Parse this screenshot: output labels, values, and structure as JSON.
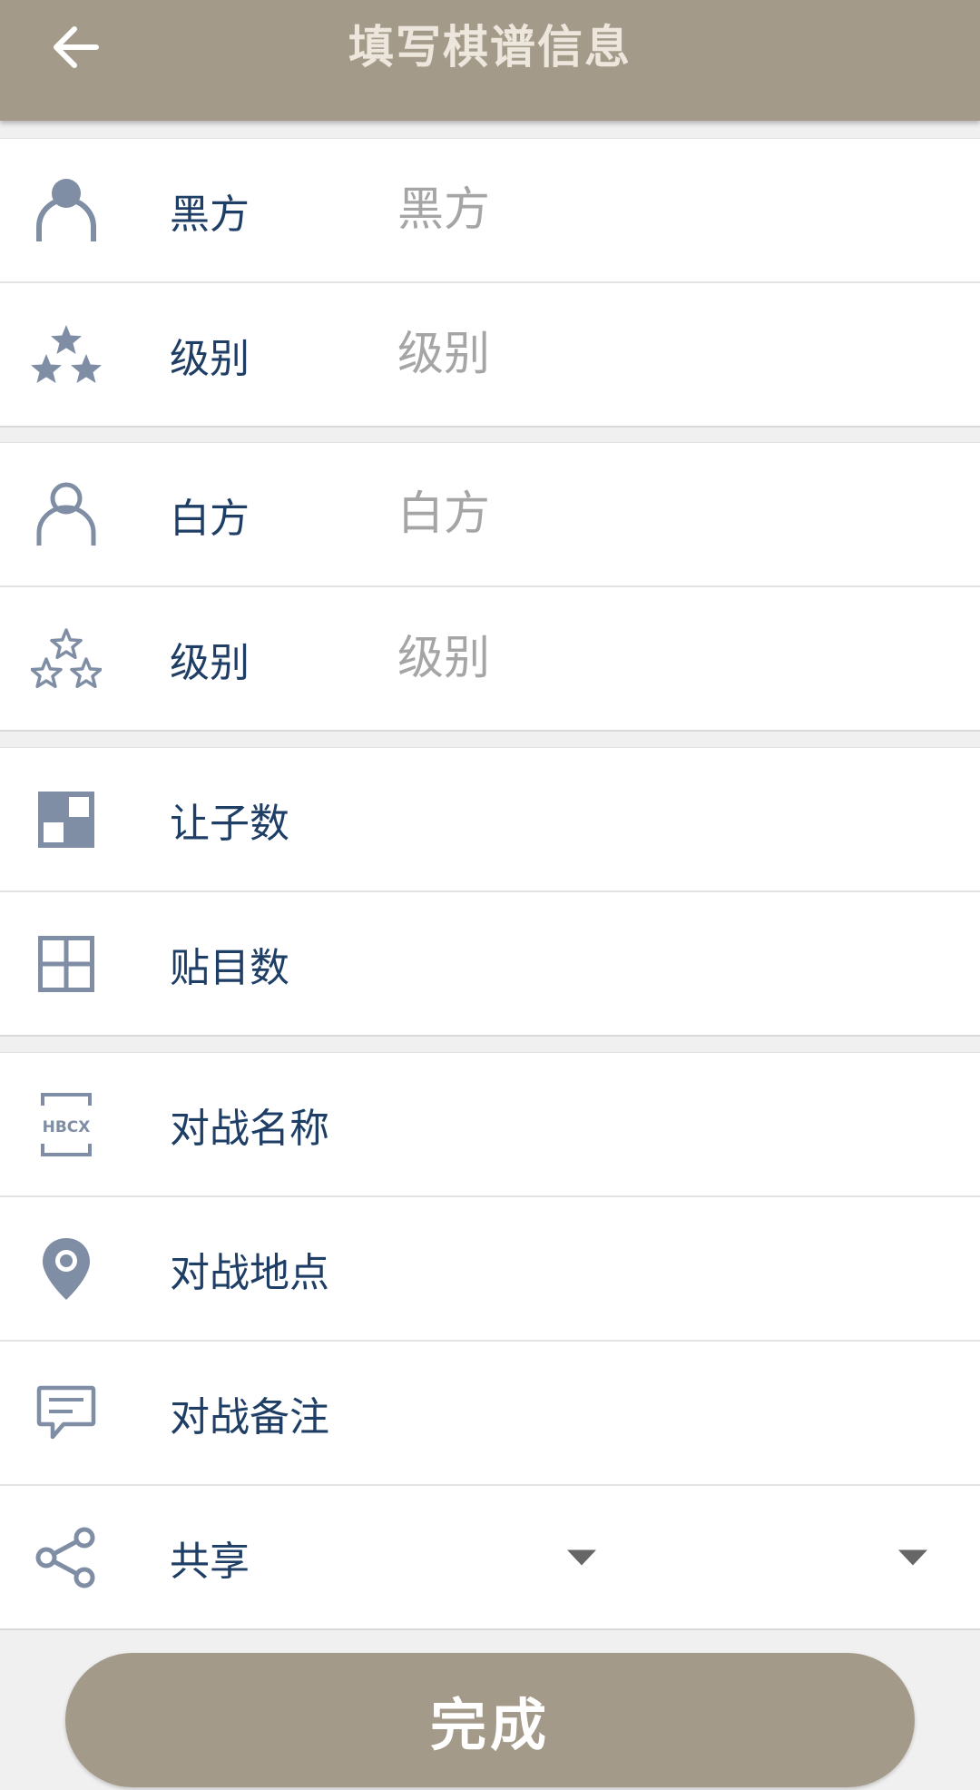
{
  "header": {
    "title": "填写棋谱信息",
    "back_icon": "arrow-left-icon"
  },
  "players": {
    "black": {
      "label": "黑方",
      "placeholder": "黑方",
      "icon": "person-filled-icon"
    },
    "black_rank": {
      "label": "级别",
      "placeholder": "级别",
      "icon": "stars-filled-icon"
    },
    "white": {
      "label": "白方",
      "placeholder": "白方",
      "icon": "person-outline-icon"
    },
    "white_rank": {
      "label": "级别",
      "placeholder": "级别",
      "icon": "stars-outline-icon"
    }
  },
  "rules": {
    "handicap": {
      "label": "让子数",
      "icon": "handicap-grid-icon"
    },
    "komi": {
      "label": "贴目数",
      "icon": "grid-icon"
    }
  },
  "match": {
    "name": {
      "label": "对战名称",
      "icon": "hbcx-badge-icon",
      "icon_text": "HBCX"
    },
    "location": {
      "label": "对战地点",
      "icon": "location-pin-icon"
    },
    "notes": {
      "label": "对战备注",
      "icon": "comment-icon"
    },
    "share": {
      "label": "共享",
      "icon": "share-icon"
    }
  },
  "actions": {
    "done_label": "完成"
  },
  "colors": {
    "brand": "#a49a89",
    "label_text": "#1e3e66",
    "icon": "#7f8ea4",
    "placeholder": "#a5a5a5"
  }
}
